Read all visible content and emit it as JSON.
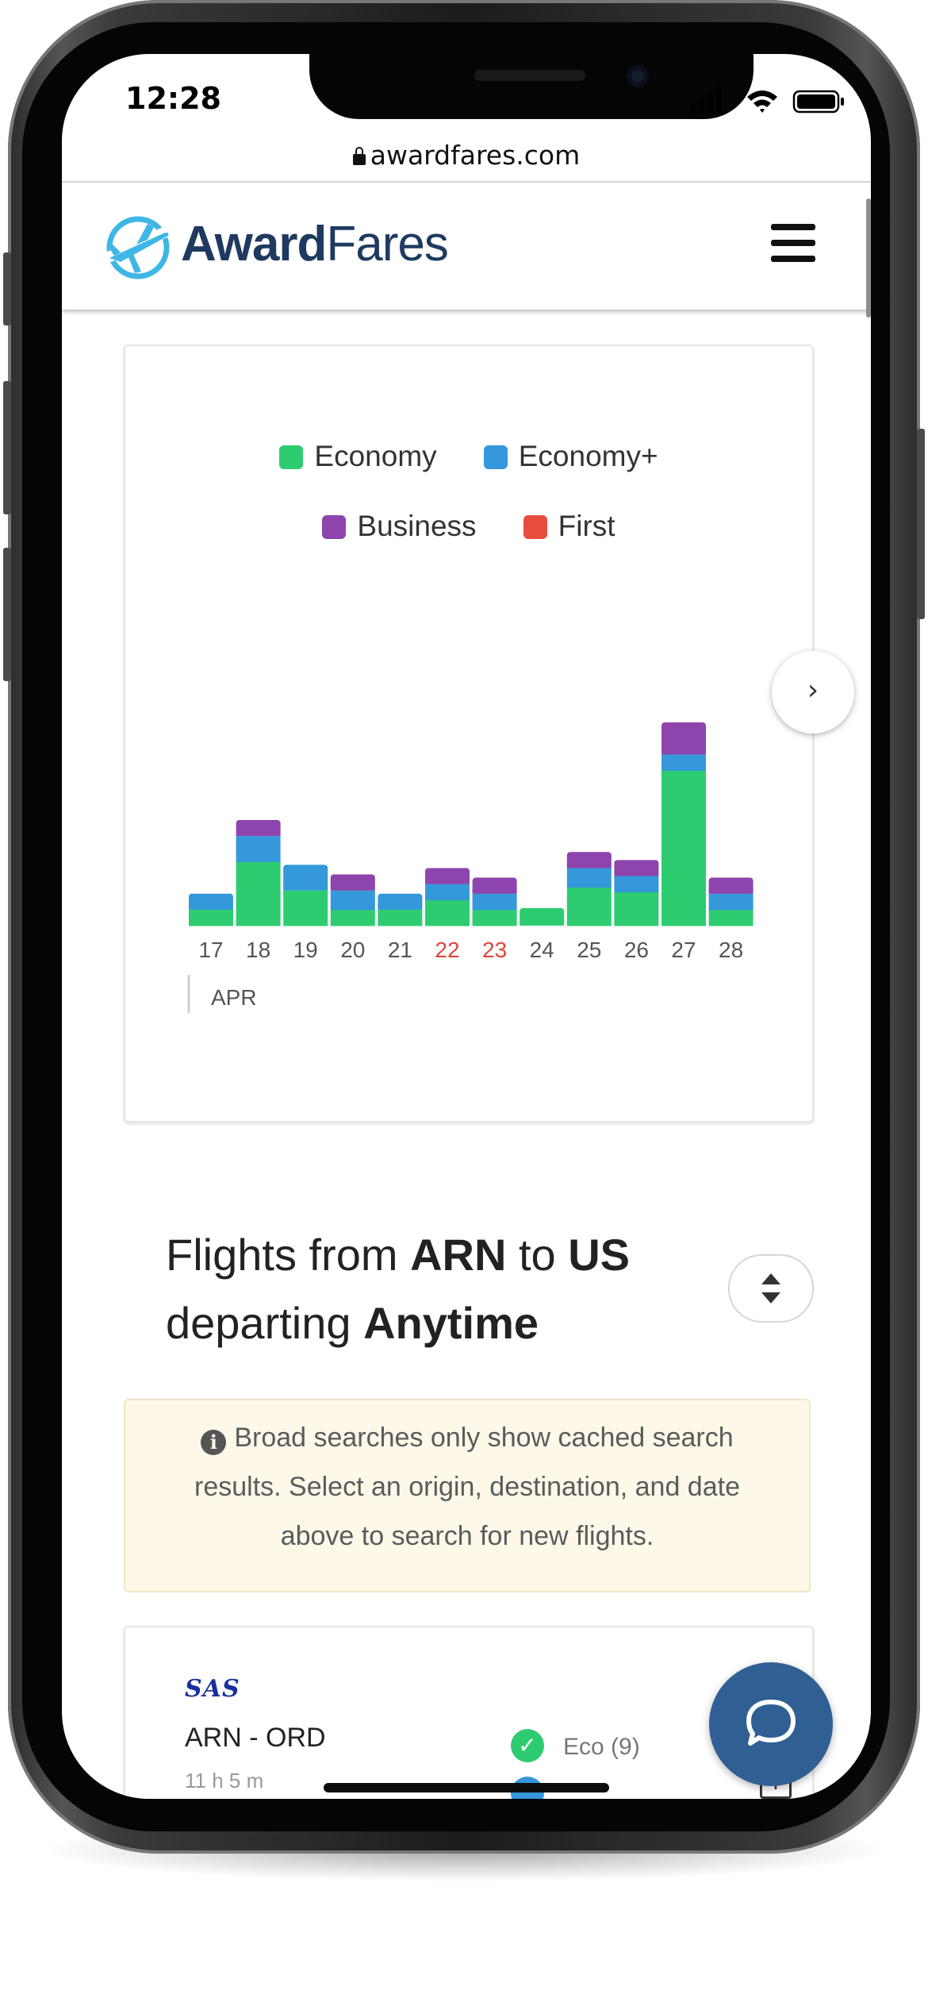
{
  "status_bar": {
    "time": "12:28"
  },
  "browser": {
    "url": "awardfares.com"
  },
  "brand": {
    "name_bold": "Award",
    "name_light": "Fares"
  },
  "chart_data": {
    "type": "bar",
    "stacked": true,
    "legend": [
      "Economy",
      "Economy+",
      "Business",
      "First"
    ],
    "legend_position": "top",
    "colors": {
      "Economy": "#2ecc71",
      "Economy+": "#3498db",
      "Business": "#8e44ad",
      "First": "#e74c3c"
    },
    "categories": [
      "17",
      "18",
      "19",
      "20",
      "21",
      "22",
      "23",
      "24",
      "25",
      "26",
      "27",
      "28"
    ],
    "weekend_categories": [
      "22",
      "23"
    ],
    "weekend_color": "#e0463a",
    "month_label": "APR",
    "series": [
      {
        "name": "Economy",
        "values": [
          1,
          4,
          2.2,
          1,
          1,
          1.6,
          1,
          1.1,
          2.4,
          2.1,
          9.7,
          1
        ]
      },
      {
        "name": "Economy+",
        "values": [
          1,
          1.6,
          1.6,
          1.2,
          1,
          1,
          1,
          0,
          1.2,
          1,
          1,
          1
        ]
      },
      {
        "name": "Business",
        "values": [
          0,
          1,
          0,
          1,
          0,
          1,
          1,
          0,
          1,
          1,
          2,
          1
        ]
      },
      {
        "name": "First",
        "values": [
          0,
          0,
          0,
          0,
          0,
          0,
          0,
          0,
          0,
          0,
          0,
          0
        ]
      }
    ],
    "ylim": [
      0,
      13
    ]
  },
  "results": {
    "heading_parts": [
      "Flights from ",
      "ARN",
      " to ",
      "US",
      " departing ",
      "Anytime"
    ],
    "notice": "Broad searches only show cached search results. Select an origin, destination, and date above to search for new flights."
  },
  "flight": {
    "airline": "SAS",
    "route": "ARN - ORD",
    "duration": "11 h 5 m",
    "cabin_label": "Eco (9)"
  }
}
